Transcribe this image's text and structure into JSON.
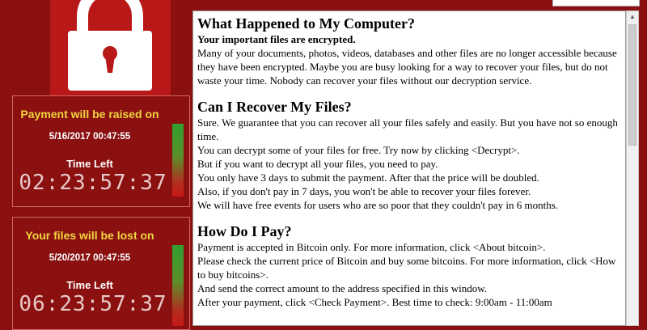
{
  "content": {
    "sections": [
      {
        "heading": "What Happened to My Computer?",
        "paragraphs": [
          "Your important files are encrypted.",
          "Many of your documents, photos, videos, databases and other files are no longer accessible because they have been encrypted. Maybe you are busy looking for a way to recover your files, but do not waste your time. Nobody can recover your files without our decryption service."
        ]
      },
      {
        "heading": "Can I Recover My Files?",
        "paragraphs": [
          "Sure. We guarantee that you can recover all your files safely and easily. But you have not so enough time.",
          "You can decrypt some of your files for free. Try now by clicking <Decrypt>.",
          "But if you want to decrypt all your files, you need to pay.",
          "You only have 3 days to submit the payment. After that the price will be doubled.",
          "Also, if you don't pay in 7 days, you won't be able to recover your files forever.",
          "We will have free events for users who are so poor that they couldn't pay in 6 months."
        ]
      },
      {
        "heading": "How Do I Pay?",
        "paragraphs": [
          "Payment is accepted in Bitcoin only. For more information, click <About bitcoin>.",
          "Please check the current price of Bitcoin and buy some bitcoins. For more information, click <How to buy bitcoins>.",
          "And send the correct amount to the address specified in this window.",
          "After your payment, click <Check Payment>. Best time to check: 9:00am - 11:00am"
        ]
      }
    ]
  },
  "timers": [
    {
      "title": "Payment will be raised on",
      "date": "5/16/2017 00:47:55",
      "time_left_label": "Time Left",
      "countdown": "02:23:57:37",
      "level": 0.65
    },
    {
      "title": "Your files will be lost on",
      "date": "5/20/2017 00:47:55",
      "time_left_label": "Time Left",
      "countdown": "06:23:57:37",
      "level": 0.9
    }
  ],
  "colors": {
    "background": "#8b1010",
    "title_yellow": "#f0d640",
    "lock_red": "#b91818"
  },
  "icons": {
    "lock": "padlock-icon"
  }
}
